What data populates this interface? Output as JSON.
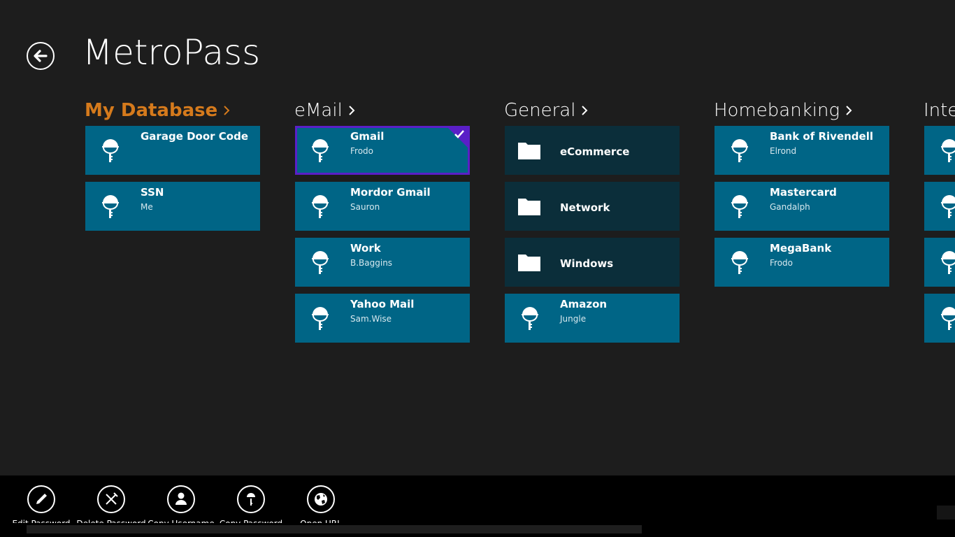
{
  "app": {
    "title": "MetroPass"
  },
  "colors": {
    "accent": "#d57a1c",
    "tile_entry": "#006586",
    "tile_folder": "#0b2e3a",
    "selection": "#5a1fc7",
    "background": "#1d1d1d",
    "appbar": "#000000"
  },
  "groups": [
    {
      "name": "My Database",
      "accent": true,
      "tiles": [
        {
          "type": "entry",
          "icon": "key-icon",
          "title": "Garage Door Code",
          "subtitle": ""
        },
        {
          "type": "entry",
          "icon": "key-icon",
          "title": "SSN",
          "subtitle": "Me"
        }
      ]
    },
    {
      "name": "eMail",
      "tiles": [
        {
          "type": "entry",
          "icon": "key-icon",
          "title": "Gmail",
          "subtitle": "Frodo",
          "selected": true
        },
        {
          "type": "entry",
          "icon": "key-icon",
          "title": "Mordor Gmail",
          "subtitle": "Sauron"
        },
        {
          "type": "entry",
          "icon": "key-icon",
          "title": "Work",
          "subtitle": "B.Baggins"
        },
        {
          "type": "entry",
          "icon": "key-icon",
          "title": "Yahoo Mail",
          "subtitle": "Sam.Wise"
        }
      ]
    },
    {
      "name": "General",
      "tiles": [
        {
          "type": "folder",
          "icon": "folder-icon",
          "title": "eCommerce"
        },
        {
          "type": "folder",
          "icon": "folder-icon",
          "title": "Network"
        },
        {
          "type": "folder",
          "icon": "folder-icon",
          "title": "Windows"
        },
        {
          "type": "entry",
          "icon": "key-icon",
          "title": "Amazon",
          "subtitle": "Jungle"
        }
      ]
    },
    {
      "name": "Homebanking",
      "tiles": [
        {
          "type": "entry",
          "icon": "key-icon",
          "title": "Bank of Rivendell",
          "subtitle": "Elrond"
        },
        {
          "type": "entry",
          "icon": "key-icon",
          "title": "Mastercard",
          "subtitle": "Gandalph"
        },
        {
          "type": "entry",
          "icon": "key-icon",
          "title": "MegaBank",
          "subtitle": "Frodo"
        }
      ]
    },
    {
      "name": "Inte",
      "tiles": [
        {
          "type": "entry",
          "icon": "key-icon",
          "title": "",
          "subtitle": ""
        },
        {
          "type": "entry",
          "icon": "key-icon",
          "title": "",
          "subtitle": ""
        },
        {
          "type": "entry",
          "icon": "key-icon",
          "title": "",
          "subtitle": ""
        },
        {
          "type": "entry",
          "icon": "key-icon",
          "title": "",
          "subtitle": ""
        }
      ]
    }
  ],
  "appbar": {
    "buttons": [
      {
        "label": "Edit Password",
        "icon": "pencil-icon"
      },
      {
        "label": "Delete Password",
        "icon": "delete-icon"
      },
      {
        "label": "Copy Username",
        "icon": "person-icon"
      },
      {
        "label": "Copy Password",
        "icon": "key-icon"
      },
      {
        "label": "Open URL",
        "icon": "globe-icon"
      }
    ]
  }
}
